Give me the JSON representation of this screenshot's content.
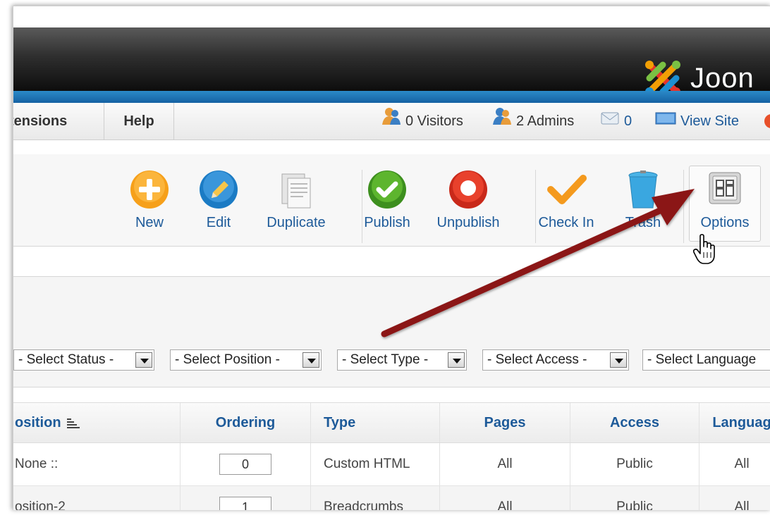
{
  "logo": {
    "text": "Joon"
  },
  "menubar": {
    "extensions_label": "tensions",
    "help_label": "Help",
    "visitors": "0 Visitors",
    "admins": "2 Admins",
    "messages": "0",
    "view_site": "View Site"
  },
  "toolbar": {
    "new": "New",
    "edit": "Edit",
    "duplicate": "Duplicate",
    "publish": "Publish",
    "unpublish": "Unpublish",
    "checkin": "Check In",
    "trash": "Trash",
    "options": "Options"
  },
  "filters": {
    "status": "- Select Status -",
    "position": "- Select Position -",
    "type": "- Select Type -",
    "access": "- Select Access -",
    "language": "- Select Language"
  },
  "table": {
    "headers": {
      "position": "osition",
      "ordering": "Ordering",
      "type": "Type",
      "pages": "Pages",
      "access": "Access",
      "language": "Languag"
    },
    "rows": [
      {
        "position": "None ::",
        "ordering": "0",
        "type": "Custom HTML",
        "pages": "All",
        "access": "Public",
        "language": "All"
      },
      {
        "position": "osition-2",
        "ordering": "1",
        "type": "Breadcrumbs",
        "pages": "All",
        "access": "Public",
        "language": "All"
      }
    ]
  },
  "colors": {
    "link": "#1d5a99",
    "header_blue": "#1a74b8",
    "arrow": "#8b1515"
  }
}
